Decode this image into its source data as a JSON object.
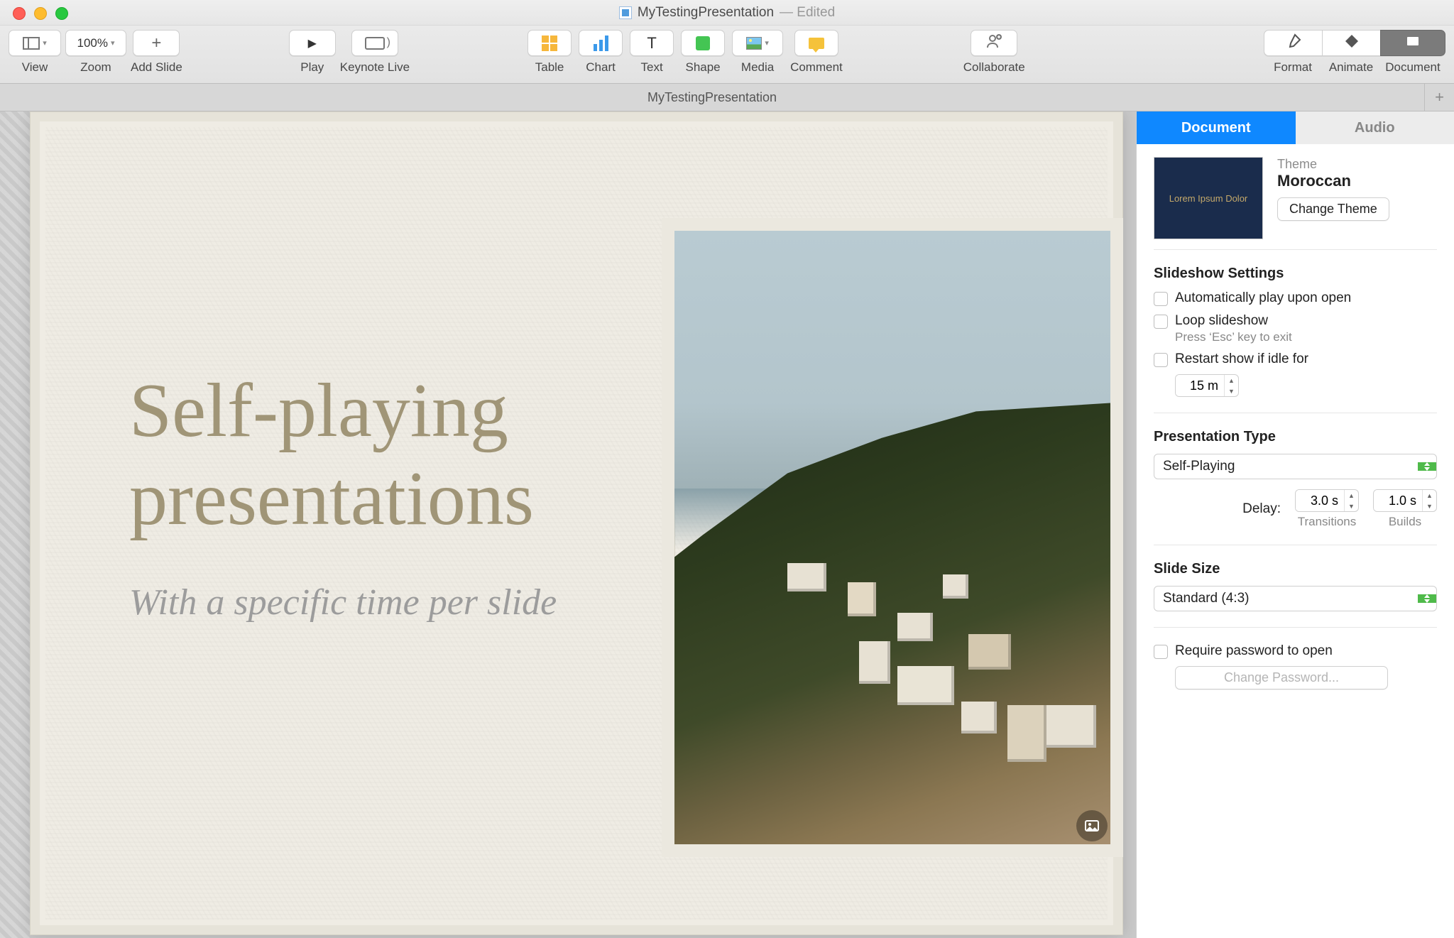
{
  "titlebar": {
    "filename": "MyTestingPresentation",
    "suffix": "— Edited"
  },
  "toolbar": {
    "view": "View",
    "zoom": "Zoom",
    "zoom_val": "100%",
    "add_slide": "Add Slide",
    "play": "Play",
    "keynote_live": "Keynote Live",
    "table": "Table",
    "chart": "Chart",
    "text": "Text",
    "shape": "Shape",
    "media": "Media",
    "comment": "Comment",
    "collaborate": "Collaborate",
    "format": "Format",
    "animate": "Animate",
    "document": "Document"
  },
  "tabstrip": {
    "doc": "MyTestingPresentation"
  },
  "slide": {
    "title": "Self-playing presentations",
    "subtitle": "With a specific time per slide"
  },
  "inspector": {
    "tabs": {
      "document": "Document",
      "audio": "Audio"
    },
    "theme": {
      "label": "Theme",
      "name": "Moroccan",
      "thumb_text": "Lorem Ipsum Dolor",
      "change_btn": "Change Theme"
    },
    "slideshow": {
      "heading": "Slideshow Settings",
      "autoplay": "Automatically play upon open",
      "loop": "Loop slideshow",
      "loop_sub": "Press ‘Esc’ key to exit",
      "restart": "Restart show if idle for",
      "idle_val": "15 m"
    },
    "pres_type": {
      "heading": "Presentation Type",
      "value": "Self-Playing",
      "delay_label": "Delay:",
      "transitions_val": "3.0 s",
      "transitions_lbl": "Transitions",
      "builds_val": "1.0 s",
      "builds_lbl": "Builds"
    },
    "slide_size": {
      "heading": "Slide Size",
      "value": "Standard (4:3)"
    },
    "password": {
      "require": "Require password to open",
      "change": "Change Password..."
    }
  }
}
